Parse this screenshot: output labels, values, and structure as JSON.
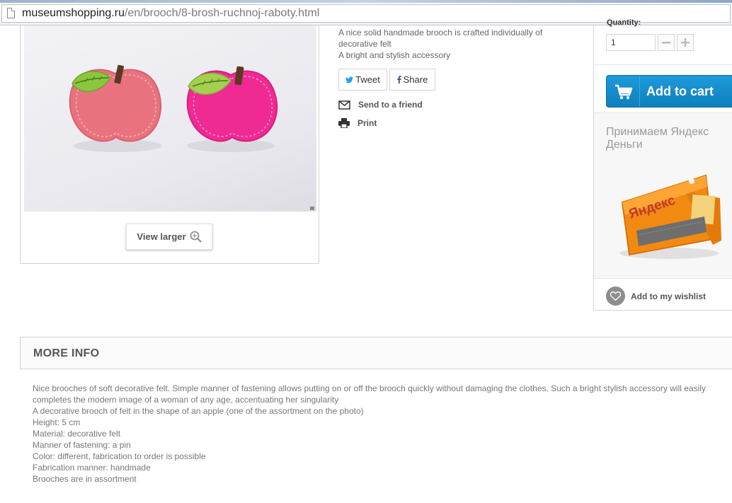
{
  "browser": {
    "url_host": "museumshopping.ru",
    "url_path": "/en/brooch/8-brosh-ruchnoj-raboty.html"
  },
  "product_image": {
    "view_larger_label": "View larger"
  },
  "description": {
    "lines": [
      "A nice solid handmade brooch is crafted individually of decorative felt",
      "A bright and stylish accessory"
    ]
  },
  "social": {
    "tweet_label": "Tweet",
    "share_label": "Share"
  },
  "actions": {
    "send_label": "Send to a friend",
    "print_label": "Print"
  },
  "buy_box": {
    "quantity_label": "Quantity:",
    "quantity_value": "1",
    "add_to_cart_label": "Add to cart",
    "yandex_promo_title": "Принимаем Яндекс Деньги",
    "yandex_wallet_logo": "Яндекс",
    "wishlist_label": "Add to my wishlist"
  },
  "more_info": {
    "title": "MORE INFO",
    "lines": [
      "Nice brooches of soft decorative felt. Simple manner of fastening allows putting on or off the brooch quickly without damaging the clothes. Such a bright stylish accessory will easily completes the modern image of a woman of any age, accentuating her singularity",
      "A decorative brooch of felt in the shape of an apple (one of the assortment on the photo)",
      "Height: 5 cm",
      "Material: decorative felt",
      "Manner of fastening: a pin",
      "Color: different, fabrication to order is possible",
      "Fabrication manner: handmade",
      "Brooches are in assortment"
    ]
  },
  "colors": {
    "cart_blue": "#1a8fd0",
    "apple_pink": "#e8737f",
    "apple_magenta": "#f02a93",
    "leaf_green": "#8cc63f",
    "wallet_orange": "#f28a12"
  }
}
